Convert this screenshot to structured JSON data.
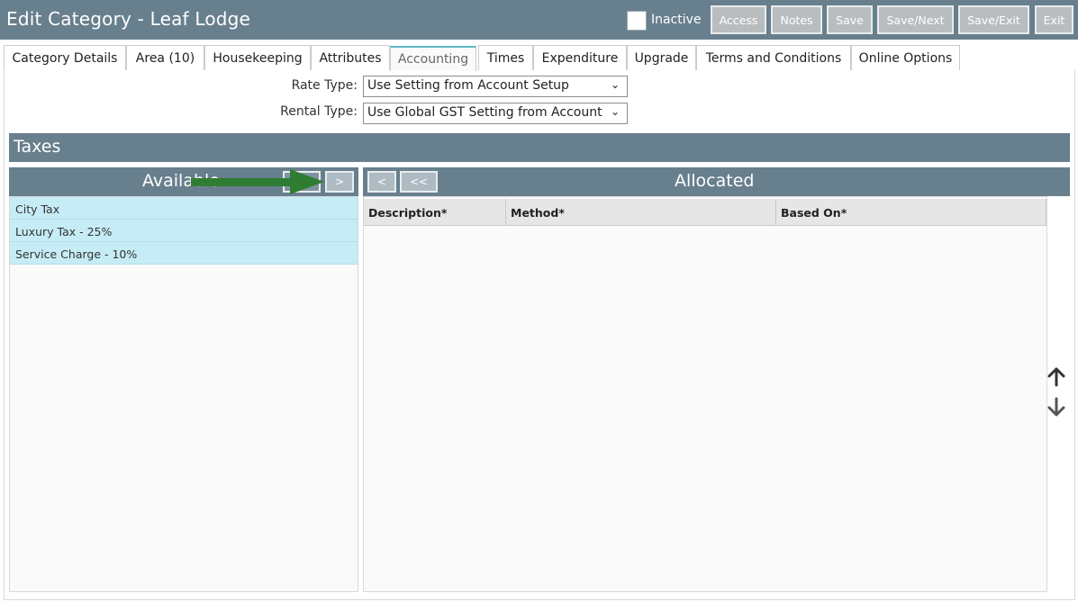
{
  "header": {
    "title": "Edit Category - Leaf Lodge",
    "inactive_label": "Inactive",
    "buttons": [
      "Access",
      "Notes",
      "Save",
      "Save/Next",
      "Save/Exit",
      "Exit"
    ]
  },
  "tabs": [
    "Category Details",
    "Area (10)",
    "Housekeeping",
    "Attributes",
    "Accounting",
    "Times",
    "Expenditure",
    "Upgrade",
    "Terms and Conditions",
    "Online Options"
  ],
  "active_tab": "Accounting",
  "form": {
    "rate_type_label": "Rate Type:",
    "rate_type_value": "Use Setting from Account Setup",
    "rental_type_label": "Rental Type:",
    "rental_type_value": "Use Global GST Setting from Account"
  },
  "section": {
    "title": "Taxes"
  },
  "available": {
    "title": "Available",
    "move_right_label": ">",
    "items": [
      "City Tax",
      "Luxury Tax - 25%",
      "Service Charge - 10%"
    ]
  },
  "allocated": {
    "title": "Allocated",
    "move_left_label": "<",
    "move_all_left_label": "<<",
    "columns": [
      "Description*",
      "Method*",
      "Based On*"
    ]
  },
  "icons": {
    "up": "arrow-up-icon",
    "down": "arrow-down-icon",
    "pointer": "green-arrow-annotation"
  },
  "colors": {
    "header_bg": "#687f8d",
    "available_item_bg": "#c6ecf5",
    "active_tab_accent": "#5cb7c4",
    "annotation_arrow": "#2e7d32"
  }
}
